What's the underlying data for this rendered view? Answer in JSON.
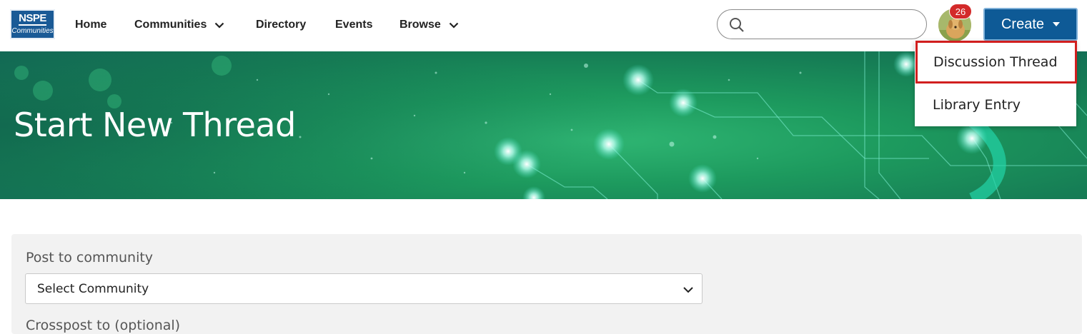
{
  "logo": {
    "top_text": "NSPE",
    "bottom_text": "Communities"
  },
  "nav": {
    "home": "Home",
    "communities": "Communities",
    "directory": "Directory",
    "events": "Events",
    "browse": "Browse"
  },
  "search": {
    "value": "",
    "placeholder": ""
  },
  "notifications": {
    "count": "26"
  },
  "create": {
    "label": "Create",
    "menu": [
      {
        "label": "Discussion Thread",
        "highlighted": true
      },
      {
        "label": "Library Entry",
        "highlighted": false
      }
    ]
  },
  "hero": {
    "title": "Start New Thread"
  },
  "form": {
    "community_label": "Post to community",
    "community_select": "Select Community",
    "next_label": "Crosspost to (optional)"
  },
  "colors": {
    "brand_blue": "#0e5a96",
    "hero_green": "#1d9a5e",
    "highlight_red": "#d11f1f",
    "badge_red": "#d32a2a"
  }
}
